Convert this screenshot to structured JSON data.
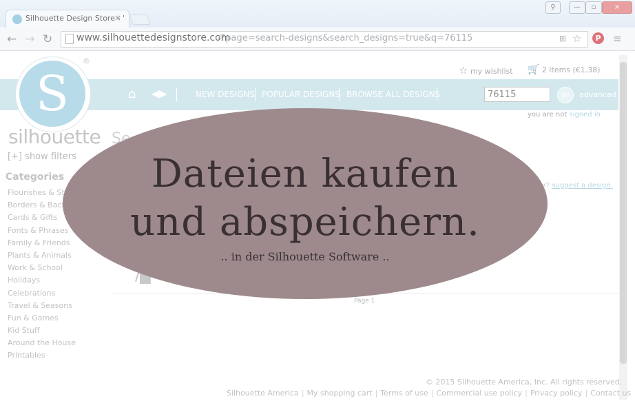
{
  "browser": {
    "tab_title": "Silhouette Design Store - '",
    "tab_close": "×",
    "url_host": "www.silhouettedesignstore.com",
    "url_path": "/?page=search-designs&search_designs=true&q=76115",
    "window_buttons": [
      "—",
      "▫",
      "×"
    ],
    "icons": [
      "back-icon",
      "forward-icon",
      "reload-icon",
      "translate-icon",
      "star-icon",
      "pinterest-icon",
      "menu-icon"
    ]
  },
  "header": {
    "wishlist": "my wishlist",
    "cart": "2 items (€1.38)",
    "signin_prefix": "you are not ",
    "signin_link": "signed in"
  },
  "logo": {
    "letter": "S",
    "registered": "®",
    "word": "silhouette"
  },
  "nav": {
    "links": [
      "NEW DESIGNS",
      "POPULAR DESIGNS",
      "BROWSE ALL DESIGNS"
    ],
    "search_value": "76115",
    "go": "go",
    "advanced": "advanced"
  },
  "main": {
    "heading": "Se",
    "filters": "[+] show filters",
    "looking_prefix": "t for? ",
    "looking_link": "suggest a design.",
    "page_label": "Page 1"
  },
  "categories": {
    "heading": "Categories",
    "items": [
      "Flourishes & Sha",
      "Borders & Back",
      "Cards & Gifts",
      "Fonts & Phrases",
      "Family & Friends",
      "Plants & Animals",
      "Work & School",
      "Holidays",
      "Celebrations",
      "Travel & Seasons",
      "Fun & Games",
      "Kid Stuff",
      "Around the House",
      "Printables"
    ]
  },
  "footer": {
    "copyright": "© 2015 Silhouette America, Inc. All rights reserved.",
    "links": [
      "Silhouette America",
      "My shopping cart",
      "Terms of use",
      "Commercial use policy",
      "Privacy policy",
      "Contact us"
    ]
  },
  "overlay": {
    "line1": "Dateien kaufen",
    "line2": "und abspeichern.",
    "subline": ".. in der Silhouette Software .."
  },
  "colors": {
    "nav_band": "#c8e3ea",
    "ellipse": "#9e8a8c",
    "overlay_text": "#3a3034"
  }
}
